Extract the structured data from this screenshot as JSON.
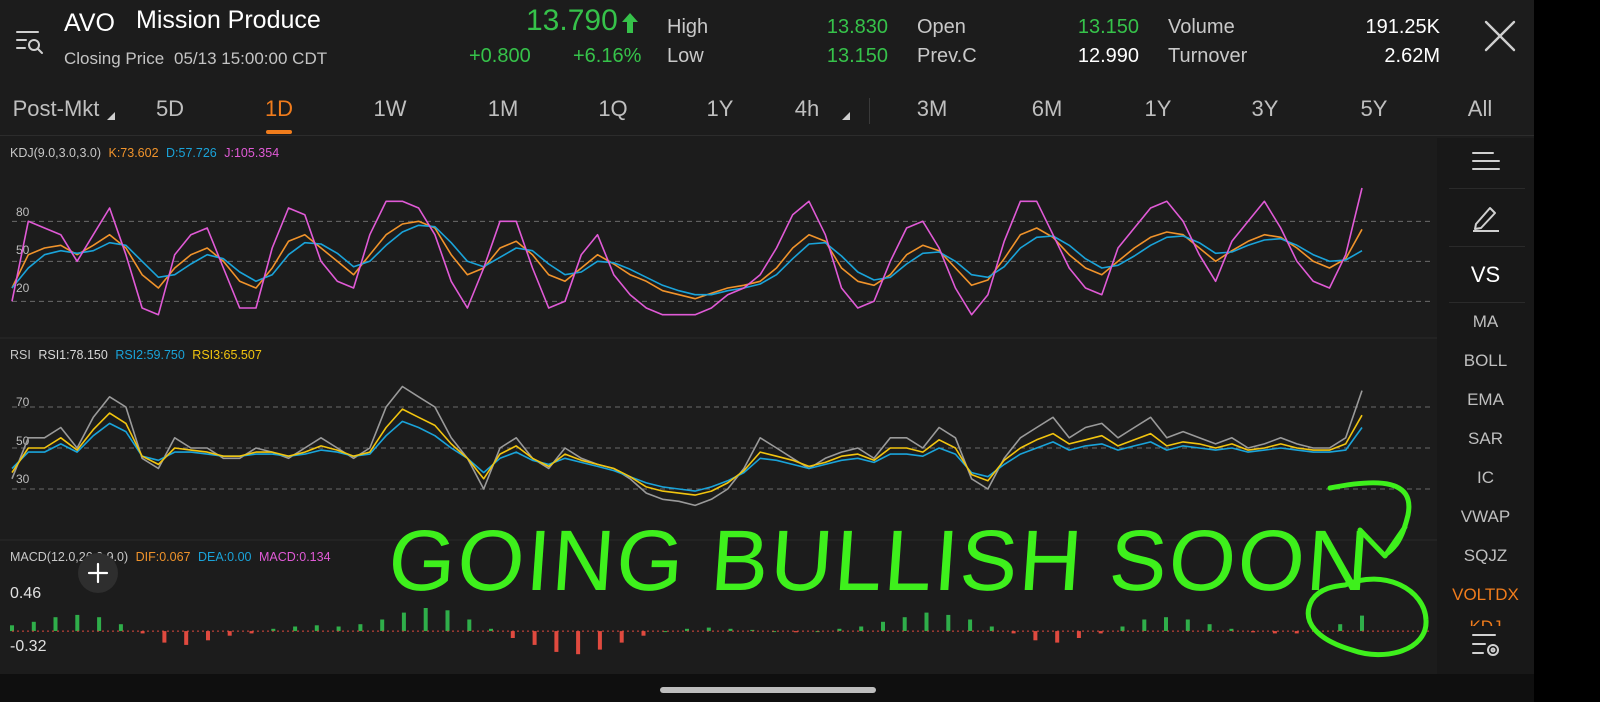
{
  "header": {
    "ticker": "AVO",
    "company": "Mission Produce",
    "closing_label": "Closing Price",
    "closing_time": "05/13 15:00:00 CDT",
    "price": "13.790",
    "change": "+0.800",
    "change_pct": "+6.16%",
    "high_label": "High",
    "high": "13.830",
    "low_label": "Low",
    "low": "13.150",
    "open_label": "Open",
    "open": "13.150",
    "prevc_label": "Prev.C",
    "prevc": "12.990",
    "volume_label": "Volume",
    "volume": "191.25K",
    "turnover_label": "Turnover",
    "turnover": "2.62M"
  },
  "tabs": [
    "Post-Mkt",
    "5D",
    "1D",
    "1W",
    "1M",
    "1Q",
    "1Y",
    "4h",
    "3M",
    "6M",
    "1Y",
    "3Y",
    "5Y",
    "All"
  ],
  "active_tab": "1D",
  "sidebar": {
    "vs_label": "VS",
    "items": [
      "MA",
      "BOLL",
      "EMA",
      "SAR",
      "IC",
      "VWAP",
      "SQJZ",
      "VOLTDX",
      "KDJ"
    ]
  },
  "kdj": {
    "name": "KDJ(9.0,3.0,3.0)",
    "k_label": "K:73.602",
    "d_label": "D:57.726",
    "j_label": "J:105.354",
    "levels": [
      "80",
      "50",
      "20"
    ]
  },
  "rsi": {
    "name": "RSI",
    "rsi1_label": "RSI1:78.150",
    "rsi2_label": "RSI2:59.750",
    "rsi3_label": "RSI3:65.507",
    "levels": [
      "70",
      "50",
      "30"
    ]
  },
  "macd": {
    "name": "MACD(12.0,26.0,9.0)",
    "dif_label": "DIF:0.067",
    "dea_label": "DEA:0.00",
    "macd_label": "MACD:0.134",
    "top_value": "0.46",
    "bottom_value": "-0.32"
  },
  "annotation": {
    "text": "GOING BULLISH SOON",
    "color": "#3ef01c"
  },
  "colors": {
    "up": "#36c24a",
    "accent": "#f07c1c",
    "k_line": "#f0932b",
    "d_line": "#1aa3d9",
    "j_line": "#e05ad6",
    "rsi1": "#9a9a9a",
    "rsi2": "#1aa3d9",
    "rsi3": "#f1c40f",
    "macd_up": "#2fae4a",
    "macd_down": "#e04a3f"
  },
  "chart_data": [
    {
      "type": "line",
      "title": "KDJ(9.0,3.0,3.0)",
      "ylim": [
        0,
        120
      ],
      "gridlines": [
        80,
        50,
        20
      ],
      "series": [
        {
          "name": "K",
          "values": [
            30,
            55,
            60,
            62,
            55,
            62,
            70,
            60,
            40,
            30,
            45,
            55,
            60,
            50,
            35,
            30,
            45,
            65,
            70,
            60,
            50,
            40,
            55,
            70,
            78,
            80,
            75,
            55,
            40,
            45,
            60,
            65,
            55,
            40,
            35,
            45,
            55,
            48,
            40,
            35,
            28,
            25,
            22,
            26,
            30,
            32,
            35,
            45,
            60,
            70,
            65,
            45,
            35,
            32,
            40,
            55,
            62,
            58,
            45,
            32,
            36,
            52,
            70,
            75,
            68,
            55,
            45,
            40,
            50,
            60,
            68,
            72,
            70,
            60,
            50,
            58,
            65,
            70,
            68,
            60,
            50,
            45,
            52,
            74
          ]
        },
        {
          "name": "D",
          "values": [
            30,
            45,
            55,
            58,
            56,
            58,
            64,
            62,
            50,
            38,
            40,
            48,
            55,
            52,
            42,
            35,
            40,
            55,
            64,
            63,
            56,
            46,
            50,
            62,
            72,
            77,
            76,
            64,
            50,
            46,
            53,
            60,
            58,
            48,
            40,
            42,
            50,
            49,
            44,
            38,
            32,
            28,
            25,
            25,
            28,
            30,
            33,
            40,
            52,
            63,
            64,
            54,
            42,
            36,
            38,
            48,
            56,
            57,
            50,
            40,
            38,
            46,
            60,
            68,
            69,
            62,
            52,
            45,
            47,
            54,
            62,
            68,
            69,
            64,
            56,
            57,
            62,
            66,
            67,
            62,
            55,
            50,
            51,
            58
          ]
        },
        {
          "name": "J",
          "values": [
            20,
            80,
            75,
            70,
            50,
            70,
            90,
            55,
            15,
            10,
            55,
            70,
            75,
            45,
            15,
            15,
            60,
            90,
            85,
            50,
            35,
            30,
            70,
            95,
            95,
            90,
            70,
            35,
            15,
            45,
            80,
            80,
            45,
            15,
            20,
            55,
            70,
            40,
            25,
            15,
            10,
            10,
            10,
            15,
            25,
            30,
            40,
            60,
            85,
            95,
            70,
            30,
            15,
            20,
            50,
            75,
            80,
            60,
            30,
            10,
            25,
            65,
            95,
            95,
            70,
            45,
            30,
            25,
            60,
            75,
            90,
            95,
            80,
            55,
            35,
            65,
            80,
            95,
            75,
            50,
            35,
            30,
            55,
            105
          ]
        }
      ]
    },
    {
      "type": "line",
      "title": "RSI",
      "ylim": [
        10,
        90
      ],
      "gridlines": [
        70,
        50,
        30
      ],
      "series": [
        {
          "name": "RSI1",
          "values": [
            35,
            55,
            55,
            60,
            50,
            65,
            75,
            70,
            45,
            40,
            55,
            50,
            50,
            45,
            45,
            50,
            48,
            45,
            50,
            55,
            50,
            45,
            50,
            70,
            80,
            75,
            70,
            55,
            45,
            30,
            50,
            55,
            45,
            40,
            50,
            45,
            42,
            40,
            35,
            28,
            25,
            24,
            22,
            25,
            30,
            40,
            55,
            50,
            45,
            40,
            45,
            48,
            50,
            45,
            55,
            55,
            50,
            60,
            55,
            35,
            30,
            45,
            55,
            60,
            65,
            55,
            60,
            62,
            55,
            60,
            65,
            55,
            58,
            55,
            52,
            55,
            50,
            52,
            55,
            52,
            50,
            50,
            55,
            78
          ]
        },
        {
          "name": "RSI2",
          "values": [
            40,
            48,
            48,
            52,
            48,
            56,
            62,
            58,
            46,
            44,
            48,
            48,
            47,
            46,
            46,
            47,
            47,
            46,
            47,
            49,
            48,
            46,
            47,
            56,
            63,
            60,
            56,
            50,
            45,
            38,
            45,
            48,
            44,
            42,
            45,
            43,
            41,
            39,
            36,
            33,
            31,
            30,
            29,
            31,
            34,
            38,
            45,
            44,
            42,
            40,
            42,
            44,
            45,
            43,
            47,
            47,
            46,
            50,
            47,
            38,
            36,
            42,
            47,
            50,
            53,
            49,
            51,
            52,
            49,
            51,
            53,
            49,
            51,
            50,
            49,
            50,
            48,
            49,
            50,
            49,
            48,
            48,
            49,
            60
          ]
        },
        {
          "name": "RSI3",
          "values": [
            38,
            50,
            50,
            55,
            49,
            59,
            67,
            62,
            46,
            42,
            50,
            49,
            48,
            46,
            46,
            48,
            48,
            46,
            48,
            51,
            49,
            46,
            48,
            60,
            69,
            65,
            61,
            52,
            45,
            35,
            47,
            51,
            45,
            41,
            47,
            44,
            42,
            40,
            36,
            31,
            29,
            28,
            27,
            29,
            33,
            39,
            48,
            46,
            44,
            41,
            43,
            46,
            47,
            44,
            50,
            50,
            48,
            54,
            50,
            37,
            34,
            44,
            50,
            54,
            57,
            52,
            54,
            56,
            51,
            54,
            57,
            51,
            53,
            52,
            50,
            52,
            49,
            50,
            52,
            50,
            49,
            49,
            52,
            66
          ]
        }
      ]
    },
    {
      "type": "bar",
      "title": "MACD(12.0,26.0,9.0)",
      "ylim": [
        -0.32,
        0.46
      ],
      "series": [
        {
          "name": "MACD",
          "values": [
            0.05,
            0.08,
            0.12,
            0.14,
            0.12,
            0.06,
            -0.02,
            -0.1,
            -0.12,
            -0.08,
            -0.04,
            -0.02,
            0.02,
            0.04,
            0.05,
            0.04,
            0.06,
            0.1,
            0.16,
            0.2,
            0.18,
            0.1,
            0.02,
            -0.06,
            -0.12,
            -0.18,
            -0.2,
            -0.16,
            -0.1,
            -0.04,
            0.0,
            0.02,
            0.03,
            0.02,
            0.01,
            0.0,
            -0.01,
            0.0,
            0.02,
            0.04,
            0.08,
            0.12,
            0.16,
            0.14,
            0.1,
            0.04,
            -0.02,
            -0.08,
            -0.1,
            -0.06,
            -0.02,
            0.04,
            0.1,
            0.12,
            0.1,
            0.06,
            0.02,
            -0.01,
            -0.02,
            -0.02,
            0.0,
            0.06,
            0.134
          ]
        }
      ]
    }
  ]
}
